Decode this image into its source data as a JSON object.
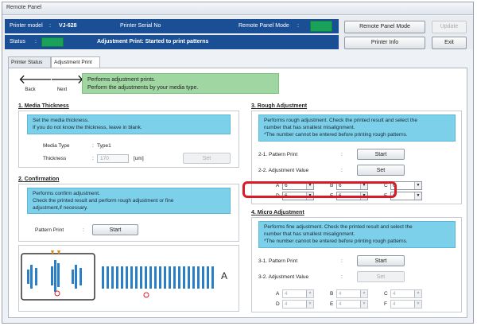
{
  "window": {
    "title": "Remote Panel"
  },
  "header": {
    "printer_model_label": "Printer model",
    "printer_model_value": "VJ-628",
    "serial_label": "Printer Serial No",
    "remote_mode_label": "Remote Panel Mode",
    "status_label": "Status",
    "status_message": "Adjustment Print: Started to print patterns",
    "buttons": {
      "remote_mode": "Remote Panel Mode",
      "update": "Update",
      "printer_info": "Printer Info",
      "exit": "Exit"
    },
    "colors": {
      "bar": "#1a4f95",
      "status_green": "#1aa15a"
    }
  },
  "tabs": [
    {
      "label": "Printer Status"
    },
    {
      "label": "Adjustment Print"
    }
  ],
  "nav": {
    "back": "Back",
    "next": "Next",
    "info": [
      "Performs adjustment prints.",
      "Perform the adjustments by your media type."
    ]
  },
  "media": {
    "title": "Media Thickness",
    "desc": [
      "Set the media thickness.",
      "If you do not know the thickness, leave in blank."
    ],
    "type_label": "Media Type",
    "type_value": "Type1",
    "thickness_label": "Thickness",
    "thickness_value": "170",
    "unit": "[um]",
    "set": "Set"
  },
  "confirm": {
    "title": "Confirmation",
    "desc": [
      "Performs confirm adjustment.",
      "Check the printed result and perform rough adjustment or fine",
      "adjustment,if necessary."
    ],
    "pattern_label": "Pattern Print",
    "start": "Start"
  },
  "rough": {
    "title": "Rough Adjustment",
    "desc": [
      "Performs rough adjustment. Check the printed result and select the",
      "number that has smallest misalignment.",
      "*The number cannot be entered before printing rough patterns."
    ],
    "pattern_label": "2-1. Pattern Print",
    "value_label": "2-2. Adjustment Value",
    "start": "Start",
    "set": "Set",
    "selects": [
      {
        "letter": "A",
        "value": "6"
      },
      {
        "letter": "B",
        "value": "6"
      },
      {
        "letter": "C",
        "value": "6"
      },
      {
        "letter": "D",
        "value": "6"
      },
      {
        "letter": "E",
        "value": "6"
      },
      {
        "letter": "F",
        "value": "6"
      }
    ]
  },
  "micro": {
    "title": "Micro Adjustment",
    "desc": [
      "Performs fine adjustment. Check the printed result and select the",
      "number that has smallest misalignment.",
      "*The number cannot be entered before printing rough patterns."
    ],
    "pattern_label": "3-1. Pattern Print",
    "value_label": "3-2. Adjustment Value",
    "start": "Start",
    "set": "Set",
    "selects": [
      {
        "letter": "A",
        "value": "4"
      },
      {
        "letter": "B",
        "value": "4"
      },
      {
        "letter": "C",
        "value": "4"
      },
      {
        "letter": "D",
        "value": "4"
      },
      {
        "letter": "E",
        "value": "4"
      },
      {
        "letter": "F",
        "value": "4"
      }
    ]
  },
  "section_numbers": {
    "media": "1.",
    "confirm": "2.",
    "rough": "3.",
    "micro": "4."
  },
  "pattern_letter": "A",
  "colon": ":"
}
